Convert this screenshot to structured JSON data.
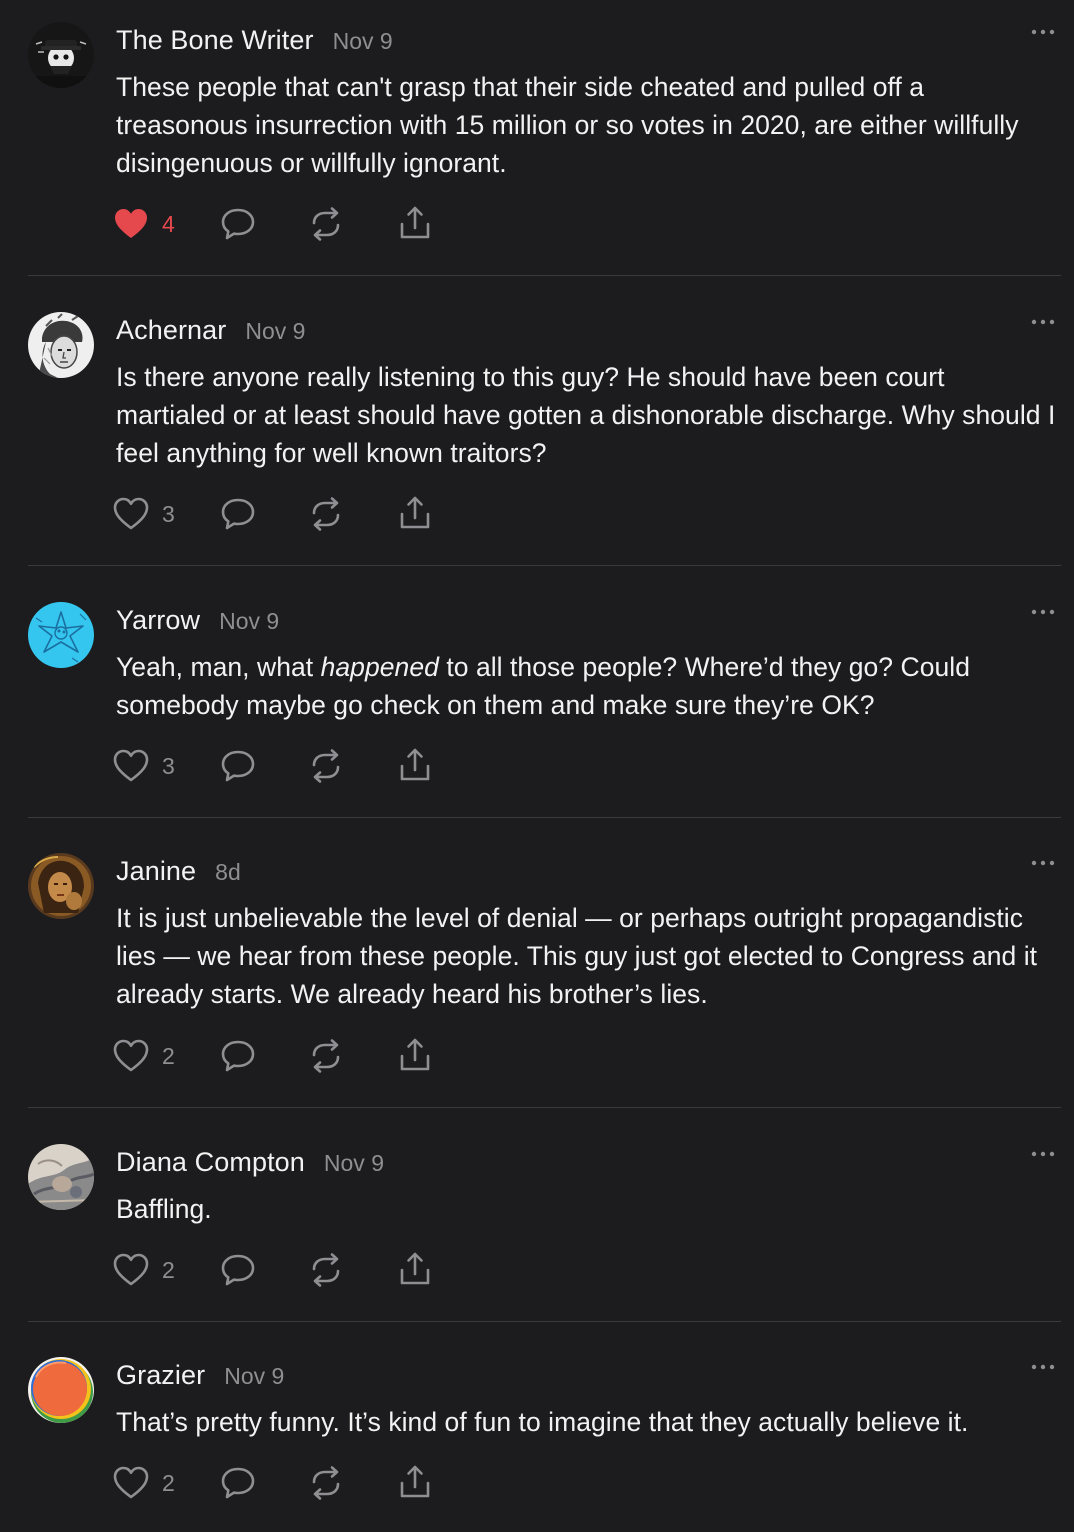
{
  "comments": [
    {
      "author": "The Bone Writer",
      "date": "Nov 9",
      "avatar": "bone-writer-avatar",
      "text": "These people that can't grasp that their side cheated and pulled off a treasonous insurrection with 15 million or so votes in 2020, are either willfully disingenuous or willfully ignorant.",
      "likes": "4",
      "liked": true
    },
    {
      "author": "Achernar",
      "date": "Nov 9",
      "avatar": "achernar-avatar",
      "text": "Is there anyone really listening to this guy? He should have been court martialed or at least should have gotten a dishonorable discharge. Why should I feel anything for well known traitors?",
      "likes": "3",
      "liked": false
    },
    {
      "author": "Yarrow",
      "date": "Nov 9",
      "avatar": "yarrow-avatar",
      "text_before": "Yeah, man, what ",
      "text_em": "happened",
      "text_after": " to all those people? Where’d they go? Could somebody maybe go check on them and make sure they’re OK?",
      "likes": "3",
      "liked": false
    },
    {
      "author": "Janine",
      "date": "8d",
      "avatar": "janine-avatar",
      "text": "It is just unbelievable the level of denial — or perhaps outright propagandistic lies — we hear from these people. This guy just got elected to Congress and it already starts. We already heard his brother’s lies.",
      "likes": "2",
      "liked": false
    },
    {
      "author": "Diana Compton",
      "date": "Nov 9",
      "avatar": "diana-compton-avatar",
      "text": "Baffling.",
      "likes": "2",
      "liked": false
    },
    {
      "author": "Grazier",
      "date": "Nov 9",
      "avatar": "grazier-avatar",
      "text": "That’s pretty funny. It’s kind of fun to imagine that they actually believe it.",
      "likes": "2",
      "liked": false
    }
  ],
  "icons": {
    "like": "heart-icon",
    "reply": "speech-bubble-icon",
    "restack": "restack-icon",
    "share": "share-icon",
    "more": "more-icon"
  },
  "colors": {
    "background": "#1c1c1e",
    "text": "#f2f2f2",
    "muted": "#8e8e93",
    "liked": "#e5484d",
    "divider": "#3a3a3c"
  }
}
